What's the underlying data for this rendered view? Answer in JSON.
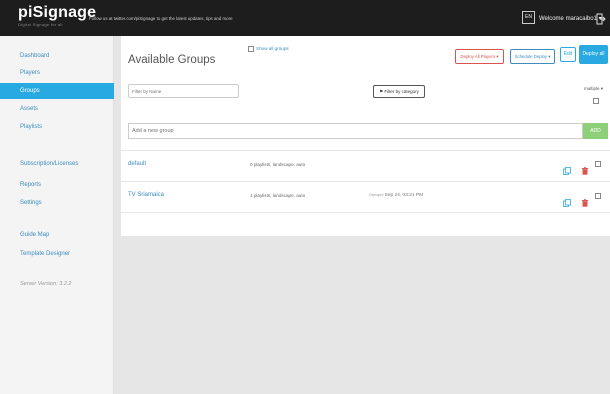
{
  "header": {
    "brand": "piSignage",
    "tagline": "Digital Signage for all",
    "follow_text": "Follow us at twitter.com/piSignage to get the latest updates, tips and more",
    "language": "EN",
    "welcome": "Welcome maracaibo1 ▾"
  },
  "sidebar": {
    "items": [
      {
        "label": "Dashboard"
      },
      {
        "label": "Players"
      },
      {
        "label": "Groups"
      },
      {
        "label": "Assets"
      },
      {
        "label": "Playlists"
      },
      {
        "label": "Subscription/Licenses"
      },
      {
        "label": "Reports"
      },
      {
        "label": "Settings"
      },
      {
        "label": "Guide Map"
      },
      {
        "label": "Template Designer"
      }
    ],
    "active_index": 2,
    "version": "Server Version: 3.2.2"
  },
  "main": {
    "title": "Available Groups",
    "show_all_label": "Show all groups",
    "buttons": {
      "deploy_all_players": "Deploy All Players ▾",
      "schedule": "Schedule Deploy ▾",
      "edit": "Edit",
      "deploy_all": "Deploy all"
    },
    "filter_placeholder": "Filter by Name",
    "filter_category": "⚑ Filter by category",
    "multiple_label": "multiple ▾",
    "add_placeholder": "Add a new group",
    "add_button": "ADD"
  },
  "groups": [
    {
      "name": "default",
      "description": "0 playlists, landscape, auto",
      "deployed_label": "",
      "deployed": ""
    },
    {
      "name": "TV Sriamaica",
      "description": "1 playlists, landscape, auto",
      "deployed_label": "Deployed",
      "deployed": "Sep 24, 03:21 PM"
    }
  ],
  "colors": {
    "topbar": "#1d1d1d",
    "accent": "#29a9e1",
    "link": "#3c8dbc",
    "danger": "#d9534f",
    "add_button": "#8ed07a"
  },
  "icons": {
    "logout": "logout-icon",
    "copy": "copy-icon",
    "delete": "trash-icon",
    "checkbox": "checkbox-icon"
  }
}
